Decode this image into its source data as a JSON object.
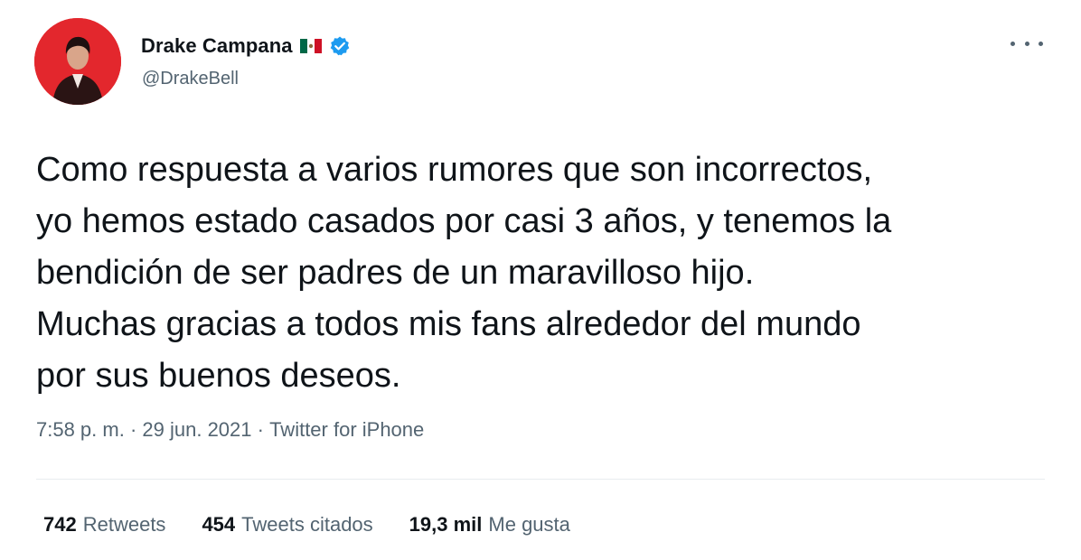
{
  "author": {
    "display_name": "Drake Campana",
    "handle": "@DrakeBell",
    "flag": "mexico-flag-icon",
    "verified": true
  },
  "tweet": {
    "text": "Como respuesta a varios rumores que son incorrectos,\nyo hemos estado casados por casi 3 años, y tenemos la\nbendición de ser padres de un maravilloso hijo.\nMuchas gracias a todos mis fans alrededor del mundo\npor sus buenos deseos.",
    "time": "7:58 p. m.",
    "separator": " · ",
    "date": "29 jun. 2021",
    "source": "Twitter for iPhone"
  },
  "stats": {
    "retweets_count": "742",
    "retweets_label": "Retweets",
    "quotes_count": "454",
    "quotes_label": "Tweets citados",
    "likes_count": "19,3 mil",
    "likes_label": "Me gusta"
  },
  "colors": {
    "text_primary": "#0f1419",
    "text_secondary": "#536471",
    "verified_blue": "#1d9bf0",
    "avatar_bg": "#e3272d"
  },
  "icons": [
    "more-icon",
    "verified-badge-icon",
    "mexico-flag-icon"
  ]
}
